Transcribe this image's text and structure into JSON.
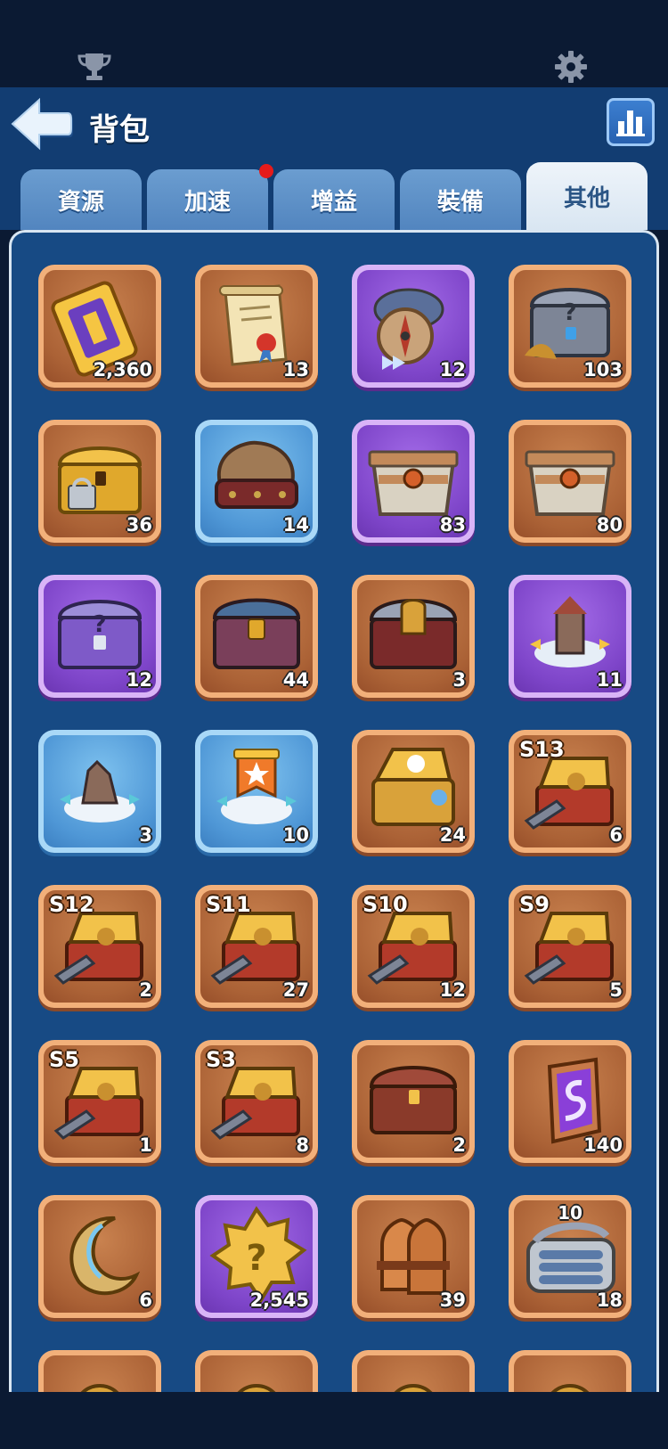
{
  "header": {
    "title": "背包",
    "icons": {
      "back": "back-arrow-icon",
      "stats": "bar-chart-icon",
      "trophy": "trophy-icon",
      "settings": "gear-icon"
    }
  },
  "tabs": [
    {
      "label": "資源",
      "active": false,
      "notification": false
    },
    {
      "label": "加速",
      "active": false,
      "notification": true
    },
    {
      "label": "增益",
      "active": false,
      "notification": false
    },
    {
      "label": "裝備",
      "active": false,
      "notification": false
    },
    {
      "label": "其他",
      "active": true,
      "notification": false
    }
  ],
  "items": [
    {
      "icon": "golden-ticket-icon",
      "rarity": "orange",
      "count": "2,360"
    },
    {
      "icon": "scroll-icon",
      "rarity": "orange",
      "count": "13"
    },
    {
      "icon": "compass-icon",
      "rarity": "purple",
      "count": "12"
    },
    {
      "icon": "mystery-chest-icon",
      "rarity": "orange",
      "count": "103"
    },
    {
      "icon": "locked-gold-chest-icon",
      "rarity": "orange",
      "count": "36"
    },
    {
      "icon": "loot-sack-icon",
      "rarity": "blue",
      "count": "14"
    },
    {
      "icon": "crate-icon",
      "rarity": "purple",
      "count": "83"
    },
    {
      "icon": "crate-icon",
      "rarity": "orange",
      "count": "80"
    },
    {
      "icon": "purple-mystery-chest-icon",
      "rarity": "purple",
      "count": "12"
    },
    {
      "icon": "iron-chest-icon",
      "rarity": "orange",
      "count": "44"
    },
    {
      "icon": "helmet-chest-icon",
      "rarity": "orange",
      "count": "3"
    },
    {
      "icon": "relocation-tower-icon",
      "rarity": "purple",
      "count": "11"
    },
    {
      "icon": "relocation-ruin-icon",
      "rarity": "blue",
      "count": "3"
    },
    {
      "icon": "relocation-banner-icon",
      "rarity": "blue",
      "count": "10"
    },
    {
      "icon": "pet-chest-icon",
      "rarity": "orange",
      "count": "24"
    },
    {
      "icon": "season-chest-icon",
      "rarity": "orange",
      "count": "6",
      "season": "S13"
    },
    {
      "icon": "season-chest-icon",
      "rarity": "orange",
      "count": "2",
      "season": "S12"
    },
    {
      "icon": "season-chest-icon",
      "rarity": "orange",
      "count": "27",
      "season": "S11"
    },
    {
      "icon": "season-chest-icon",
      "rarity": "orange",
      "count": "12",
      "season": "S10"
    },
    {
      "icon": "season-chest-icon",
      "rarity": "orange",
      "count": "5",
      "season": "S9"
    },
    {
      "icon": "season-chest-icon",
      "rarity": "orange",
      "count": "1",
      "season": "S5"
    },
    {
      "icon": "season-chest-icon",
      "rarity": "orange",
      "count": "8",
      "season": "S3"
    },
    {
      "icon": "treasure-chest-icon",
      "rarity": "orange",
      "count": "2"
    },
    {
      "icon": "purple-rune-icon",
      "rarity": "orange",
      "count": "140"
    },
    {
      "icon": "crescent-moon-icon",
      "rarity": "orange",
      "count": "6"
    },
    {
      "icon": "gold-mystery-badge-icon",
      "rarity": "purple",
      "count": "2,545"
    },
    {
      "icon": "rocket-bundle-icon",
      "rarity": "orange",
      "count": "39"
    },
    {
      "icon": "sardine-can-icon",
      "rarity": "orange",
      "count": "18",
      "topcount": "10"
    },
    {
      "icon": "partial-item-icon",
      "rarity": "orange",
      "count": ""
    },
    {
      "icon": "partial-item-icon",
      "rarity": "orange",
      "count": ""
    },
    {
      "icon": "partial-item-icon",
      "rarity": "orange",
      "count": ""
    },
    {
      "icon": "partial-item-icon",
      "rarity": "orange",
      "count": ""
    }
  ]
}
